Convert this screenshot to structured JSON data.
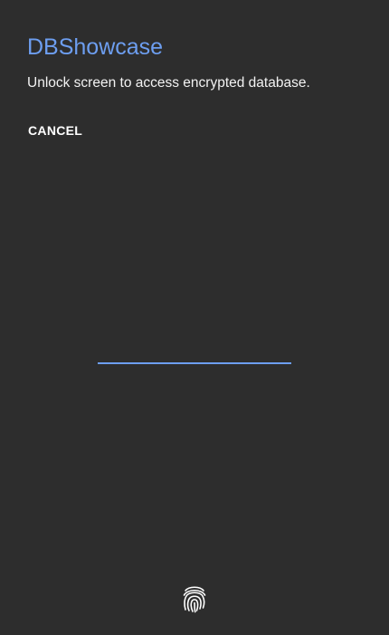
{
  "dialog": {
    "title": "DBShowcase",
    "message": "Unlock screen to access encrypted database.",
    "cancel_label": "CANCEL"
  },
  "pin_input": {
    "value": "",
    "placeholder": ""
  },
  "icons": {
    "fingerprint": "fingerprint-icon"
  },
  "colors": {
    "background": "#2d2d2d",
    "accent": "#6d9ef0",
    "text": "#ffffff"
  }
}
